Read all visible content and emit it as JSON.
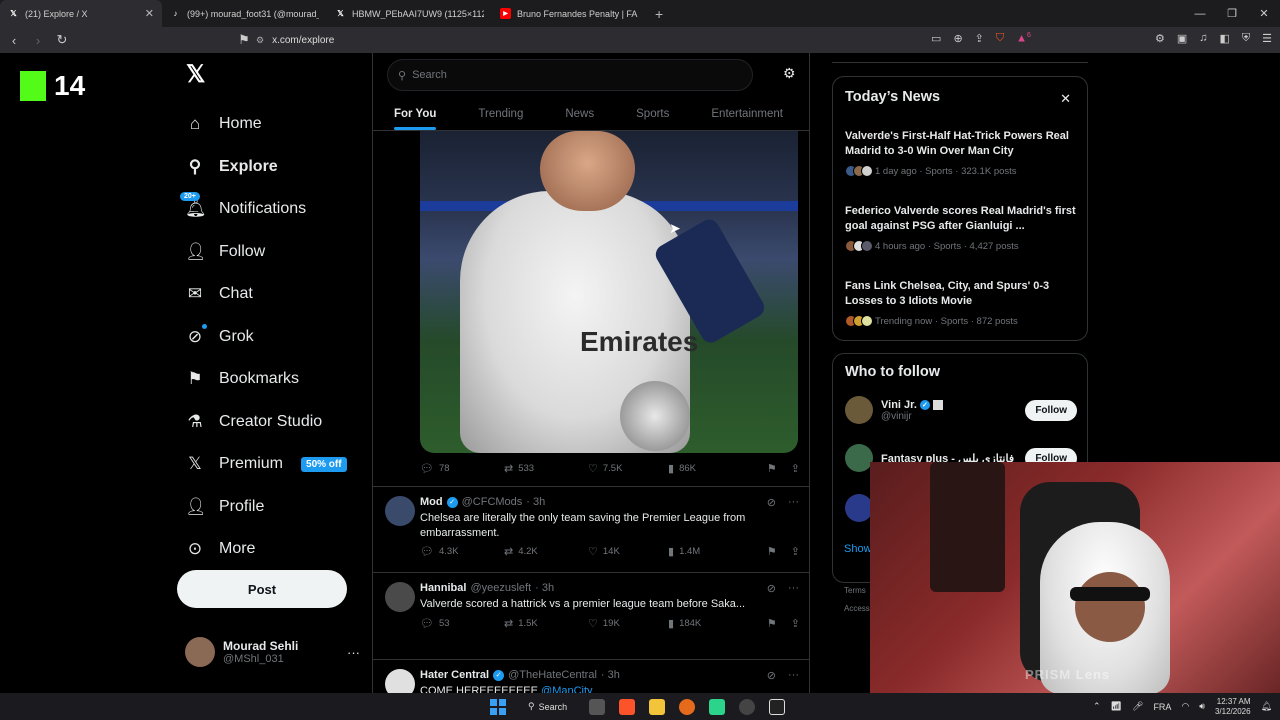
{
  "browser": {
    "tabs": [
      {
        "title": "(21) Explore / X",
        "icon": "x-icon",
        "color": "#ffffff"
      },
      {
        "title": "(99+) mourad_foot31 (@mourad_foo",
        "icon": "tiktok-icon",
        "color": "#ffffff"
      },
      {
        "title": "HBMW_PEbAAI7UW9 (1125×1125)",
        "icon": "x-icon",
        "color": "#ffffff"
      },
      {
        "title": "Bruno Fernandes Penalty | FA Cup - Y",
        "icon": "youtube-icon",
        "color": "#ff0000"
      }
    ],
    "url": "x.com/explore",
    "brave_badge": "6"
  },
  "overlay_logo": {
    "number": "14",
    "accent": "#53fc18"
  },
  "sidebar": {
    "items": [
      {
        "label": "Home",
        "icon": "home-icon",
        "glyph": "⌂"
      },
      {
        "label": "Explore",
        "icon": "search-icon",
        "glyph": "⚲"
      },
      {
        "label": "Notifications",
        "icon": "bell-icon",
        "glyph": "🔔︎",
        "badge": "20+"
      },
      {
        "label": "Follow",
        "icon": "person-add-icon",
        "glyph": "👤︎"
      },
      {
        "label": "Chat",
        "icon": "mail-icon",
        "glyph": "✉"
      },
      {
        "label": "Grok",
        "icon": "grok-icon",
        "glyph": "⊘"
      },
      {
        "label": "Bookmarks",
        "icon": "bookmark-icon",
        "glyph": "⚑"
      },
      {
        "label": "Creator Studio",
        "icon": "flask-icon",
        "glyph": "⚗"
      },
      {
        "label": "Premium",
        "icon": "x-premium-icon",
        "glyph": "𝕏",
        "badge": "50% off"
      },
      {
        "label": "Profile",
        "icon": "person-icon",
        "glyph": "👤︎"
      },
      {
        "label": "More",
        "icon": "more-circle-icon",
        "glyph": "⊙"
      }
    ],
    "post_label": "Post",
    "account": {
      "name": "Mourad Sehli",
      "handle": "@MShl_031"
    }
  },
  "explore": {
    "search_placeholder": "Search",
    "tabs": [
      "For You",
      "Trending",
      "News",
      "Sports",
      "Entertainment"
    ],
    "media_post": {
      "sponsor_text": "Emirates",
      "replies": "78",
      "reposts": "533",
      "likes": "7.5K",
      "views": "86K"
    },
    "tweets": [
      {
        "name": "Mod",
        "verified": true,
        "handle": "@CFCMods",
        "time": "· 3h",
        "text": "Chelsea are literally the only team saving the Premier League from embarrassment.",
        "link": "",
        "replies": "4.3K",
        "reposts": "4.2K",
        "likes": "14K",
        "views": "1.4M",
        "avatar_color": "#3a4a6a"
      },
      {
        "name": "Hannibal",
        "verified": false,
        "handle": "@yeezusleft",
        "time": "· 3h",
        "text": "Valverde scored a hattrick vs a premier league team before Saka...",
        "link": "",
        "replies": "53",
        "reposts": "1.5K",
        "likes": "19K",
        "views": "184K",
        "avatar_color": "#4a4a4a"
      },
      {
        "name": "Hater Central",
        "verified": true,
        "handle": "@TheHateCentral",
        "time": "· 3h",
        "text": "COME HEREEEEEEEE ",
        "link": "@ManCity",
        "replies": "",
        "reposts": "",
        "likes": "",
        "views": "",
        "avatar_color": "#e0e0e0"
      }
    ]
  },
  "todays_news": {
    "title": "Today’s News",
    "items": [
      {
        "headline": "Valverde's First-Half Hat-Trick Powers Real Madrid to 3-0 Win Over Man City",
        "meta": "1 day ago · Sports · 323.1K posts"
      },
      {
        "headline": "Federico Valverde scores Real Madrid's first goal against PSG after Gianluigi ...",
        "meta": "4 hours ago · Sports · 4,427 posts"
      },
      {
        "headline": "Fans Link Chelsea, City, and Spurs' 0-3 Losses to 3 Idiots Movie",
        "meta": "Trending now · Sports · 872 posts"
      }
    ]
  },
  "who_to_follow": {
    "title": "Who to follow",
    "users": [
      {
        "name": "Vini Jr.",
        "handle": "@vinijr",
        "button": "Follow",
        "avatar_color": "#6a5a3a"
      },
      {
        "name": "Fantasy plus - فانتازي بلس",
        "handle": "",
        "button": "Follow",
        "avatar_color": "#3a6a4a"
      }
    ],
    "show_more": "Show",
    "footer": [
      "Terms",
      "Access"
    ]
  },
  "webcam": {
    "watermark": "PRISM Lens"
  },
  "taskbar": {
    "search_label": "Search",
    "lang": "FRA",
    "time": "12:37 AM",
    "date": "3/12/2026"
  }
}
